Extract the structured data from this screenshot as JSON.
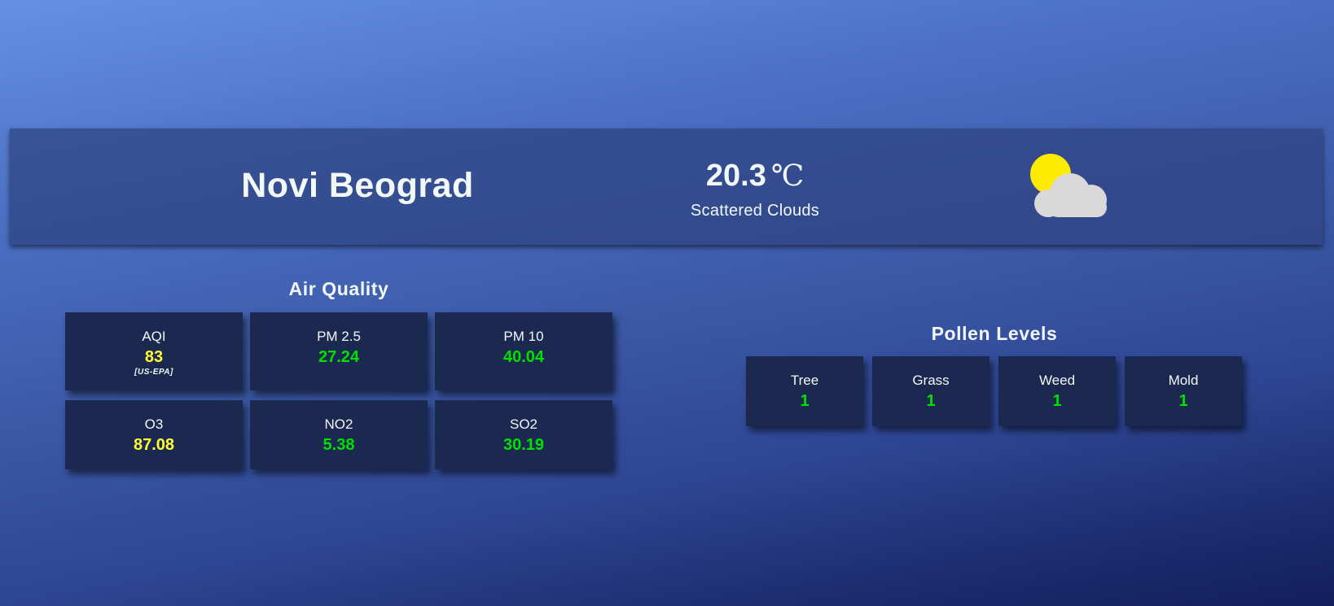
{
  "location": {
    "city": "Novi Beograd"
  },
  "current": {
    "temperature": "20.3",
    "unit": "℃",
    "condition": "Scattered Clouds",
    "icon": "partly-cloudy-icon"
  },
  "colors": {
    "good": "#00e000",
    "moderate": "#ffff33",
    "sun": "#ffeb00",
    "cloud": "#d9d9d9"
  },
  "air_quality": {
    "title": "Air Quality",
    "aqi": {
      "label": "AQI",
      "value": "83",
      "scale": "[US-EPA]"
    },
    "pm25": {
      "label": "PM 2.5",
      "value": "27.24"
    },
    "pm10": {
      "label": "PM 10",
      "value": "40.04"
    },
    "o3": {
      "label": "O3",
      "value": "87.08"
    },
    "no2": {
      "label": "NO2",
      "value": "5.38"
    },
    "so2": {
      "label": "SO2",
      "value": "30.19"
    }
  },
  "pollen": {
    "title": "Pollen Levels",
    "tree": {
      "label": "Tree",
      "value": "1"
    },
    "grass": {
      "label": "Grass",
      "value": "1"
    },
    "weed": {
      "label": "Weed",
      "value": "1"
    },
    "mold": {
      "label": "Mold",
      "value": "1"
    }
  }
}
